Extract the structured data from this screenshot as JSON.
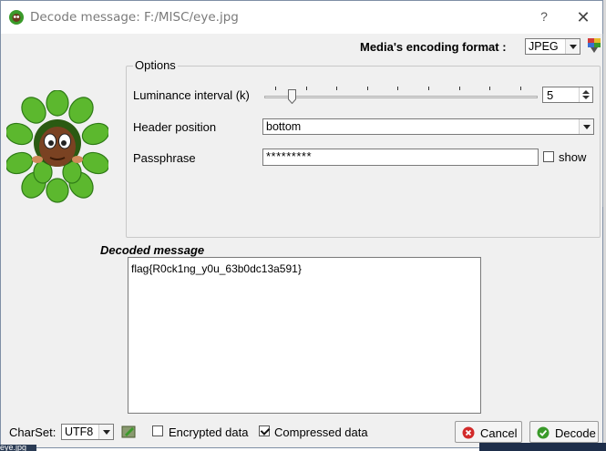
{
  "window": {
    "title": "Decode message: F:/MISC/eye.jpg",
    "help_label": "?",
    "close_label": "✕"
  },
  "encoding": {
    "label": "Media's encoding format :",
    "value": "JPEG"
  },
  "options": {
    "legend": "Options",
    "luminance_label": "Luminance interval (k)",
    "luminance_value": "5",
    "slider_fraction": 0.1,
    "header_label": "Header position",
    "header_value": "bottom",
    "passphrase_label": "Passphrase",
    "passphrase_value": "*********",
    "show_label": "show",
    "show_checked": false
  },
  "decoded": {
    "title": "Decoded message",
    "text": "flag{R0ck1ng_y0u_63b0dc13a591}"
  },
  "bottom": {
    "charset_label": "CharSet:",
    "charset_value": "UTF8",
    "encrypted_label": "Encrypted data",
    "encrypted_checked": false,
    "compressed_label": "Compressed data",
    "compressed_checked": true,
    "cancel_label": "Cancel",
    "decode_label": "Decode"
  },
  "background": {
    "left_text": "eye.jpg"
  },
  "colors": {
    "accent_green": "#3a9a2a",
    "cancel_red": "#d22a2a",
    "title_gray": "#7a7a7a"
  }
}
